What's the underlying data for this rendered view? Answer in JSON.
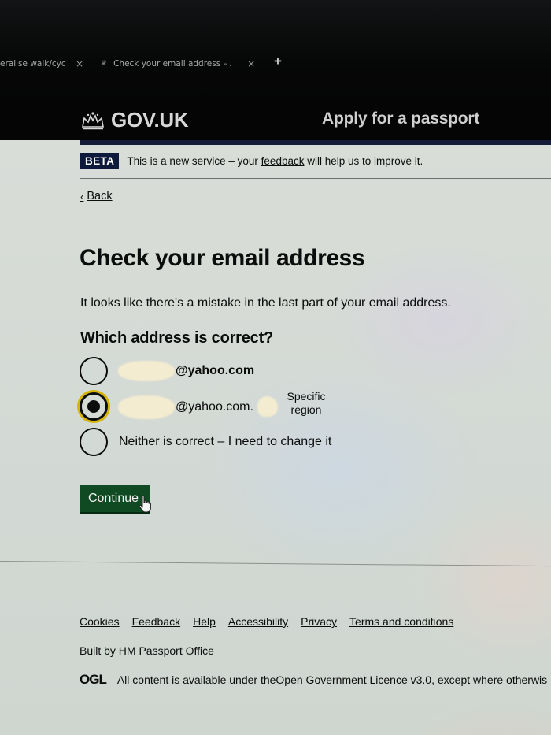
{
  "browser": {
    "tabs": [
      {
        "title": "eralise walk/cycle",
        "close": "×",
        "active": false
      },
      {
        "title": "Check your email address – Ap",
        "close": "×",
        "active": true,
        "favicon": "crown-icon"
      }
    ],
    "new_tab": "+"
  },
  "header": {
    "logo_text": "GOV.UK",
    "service_name": "Apply for a passport"
  },
  "phase_banner": {
    "tag": "BETA",
    "text_before": "This is a new service – your ",
    "link": "feedback",
    "text_after": " will help us to improve it."
  },
  "back_link": {
    "chevron": "‹",
    "label": "Back"
  },
  "page": {
    "title": "Check your email address",
    "lede": "It looks like there's a mistake in the last part of your email address.",
    "question": "Which address is correct?",
    "options": [
      {
        "label": "@yahoo.com",
        "selected": false,
        "redacted_prefix": true
      },
      {
        "label": "@yahoo.com.",
        "selected": true,
        "redacted_prefix": true,
        "annotation": "Specific region"
      },
      {
        "label": "Neither is correct – I need to change it",
        "selected": false
      }
    ],
    "annotation_line1": "Specific",
    "annotation_line2": "region",
    "continue_label": "Continue"
  },
  "footer": {
    "links": [
      "Cookies",
      "Feedback",
      "Help",
      "Accessibility",
      "Privacy",
      "Terms and conditions"
    ],
    "built_by": "Built by HM Passport Office",
    "ogl_logo": "OGL",
    "licence_before": "All content is available under the ",
    "licence_link": "Open Government Licence v3.0",
    "licence_after": ", except where otherwis"
  },
  "colors": {
    "header_bg": "#050505",
    "beta_tag": "#0e1a3c",
    "button_green": "#0f4a22",
    "focus_yellow": "#d7b400"
  }
}
